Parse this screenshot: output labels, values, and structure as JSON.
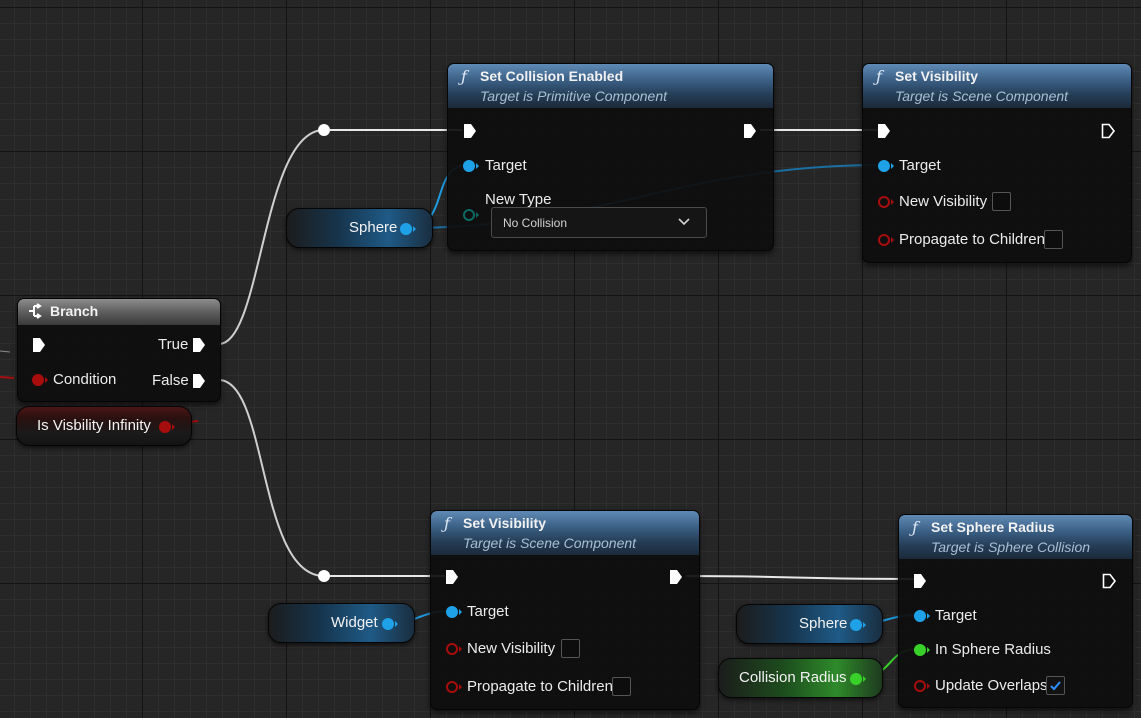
{
  "nodes": {
    "set_collision": {
      "title": "Set Collision Enabled",
      "subtitle": "Target is Primitive Component",
      "target_label": "Target",
      "new_type_label": "New Type",
      "new_type_value": "No Collision"
    },
    "set_visibility_top": {
      "title": "Set Visibility",
      "subtitle": "Target is Scene Component",
      "target_label": "Target",
      "new_visibility_label": "New Visibility",
      "new_visibility_checked": false,
      "propagate_label": "Propagate to Children",
      "propagate_checked": false
    },
    "branch": {
      "title": "Branch",
      "true_label": "True",
      "condition_label": "Condition",
      "false_label": "False"
    },
    "set_visibility_bottom": {
      "title": "Set Visibility",
      "subtitle": "Target is Scene Component",
      "target_label": "Target",
      "new_visibility_label": "New Visibility",
      "new_visibility_checked": false,
      "propagate_label": "Propagate to Children",
      "propagate_checked": false
    },
    "set_sphere_radius": {
      "title": "Set Sphere Radius",
      "subtitle": "Target is Sphere Collision",
      "target_label": "Target",
      "radius_label": "In Sphere Radius",
      "update_overlaps_label": "Update Overlaps",
      "update_overlaps_checked": true
    }
  },
  "getters": {
    "sphere_top": "Sphere",
    "is_visibility_infinity": "Is Visbility Infinity",
    "widget": "Widget",
    "sphere_bottom": "Sphere",
    "collision_radius": "Collision Radius"
  },
  "icons": {
    "function": "function-icon",
    "branch": "branch-icon",
    "exec": "exec-arrow-icon",
    "dropdown": "chevron-down-icon",
    "check": "checkmark-icon"
  },
  "colors": {
    "object_pin": "#1fa1e8",
    "bool_pin": "#a80d0d",
    "float_pin": "#37d12a",
    "enum_pin": "#0b5a56",
    "exec_wire": "#ffffff",
    "function_header": "#3a5e83",
    "branch_header": "#6e6e6e"
  }
}
